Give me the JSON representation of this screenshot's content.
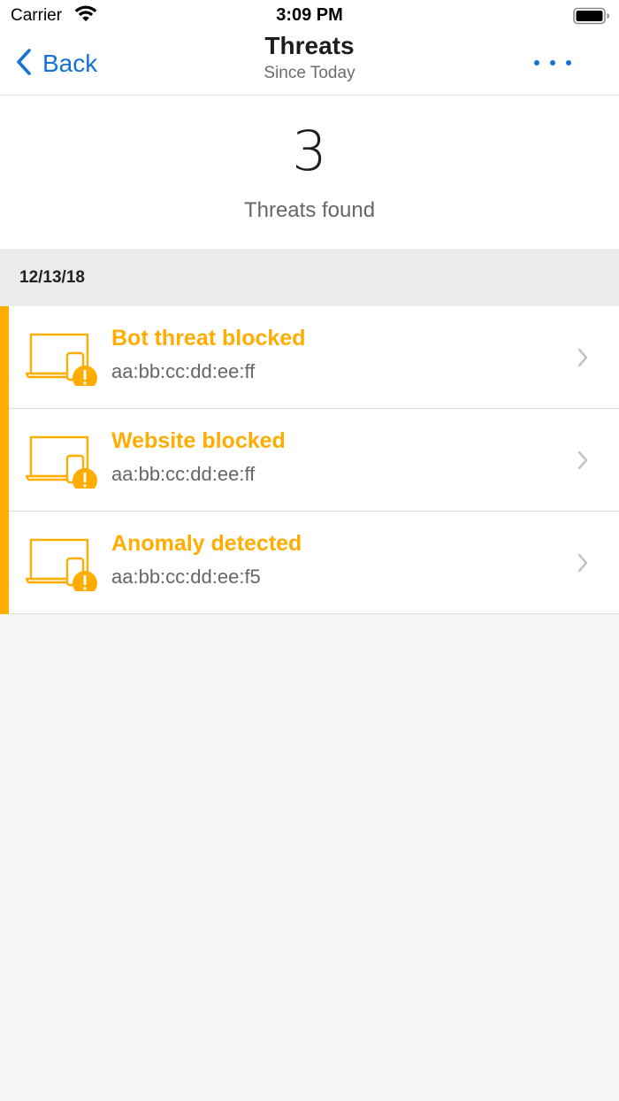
{
  "status_bar": {
    "carrier": "Carrier",
    "time": "3:09 PM",
    "icons": [
      "wifi-icon",
      "battery-icon"
    ]
  },
  "nav": {
    "back_label": "Back",
    "title": "Threats",
    "subtitle": "Since Today",
    "more_icon": "more-dots-icon",
    "accent_color": "#1572d3"
  },
  "summary": {
    "count": "3",
    "label": "Threats found"
  },
  "section": {
    "date": "12/13/18"
  },
  "threats": [
    {
      "title": "Bot threat blocked",
      "mac": "aa:bb:cc:dd:ee:ff",
      "icon": "device-warning-icon"
    },
    {
      "title": "Website blocked",
      "mac": "aa:bb:cc:dd:ee:ff",
      "icon": "device-warning-icon"
    },
    {
      "title": "Anomaly detected",
      "mac": "aa:bb:cc:dd:ee:f5",
      "icon": "device-warning-icon"
    }
  ],
  "colors": {
    "warning": "#ffad00",
    "background": "#f6f6f6"
  }
}
